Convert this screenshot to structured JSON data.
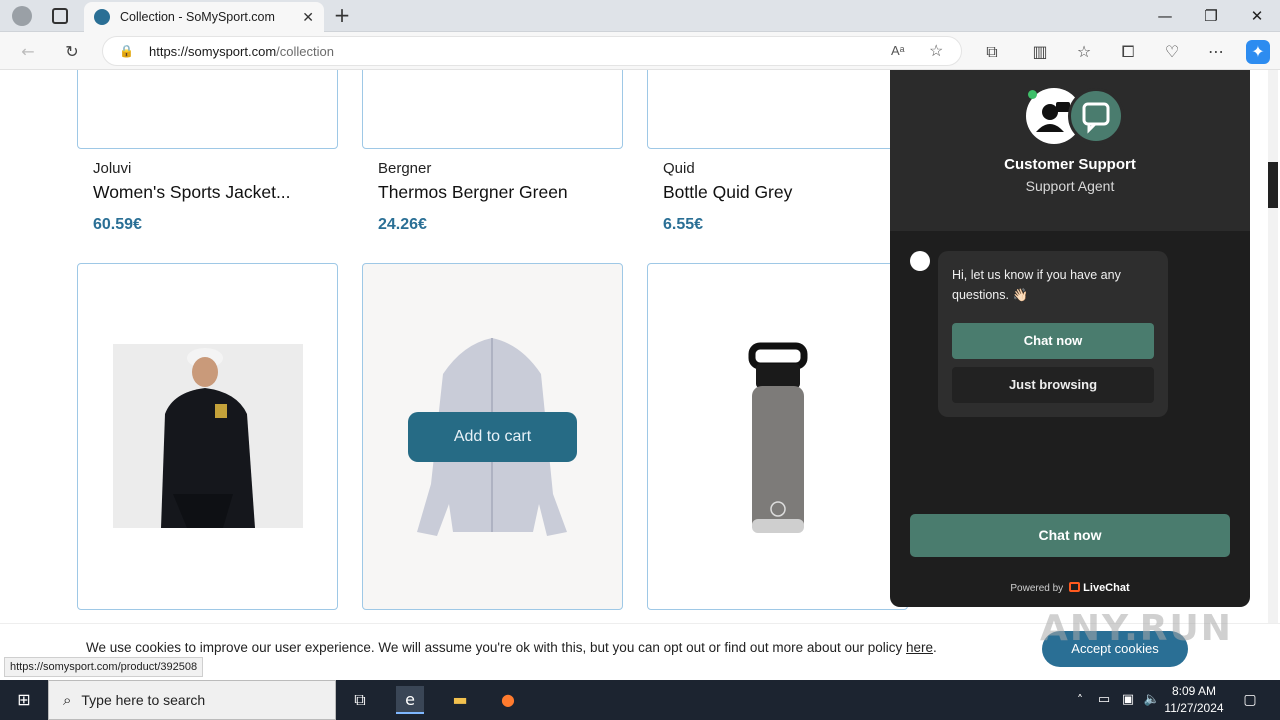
{
  "browser": {
    "tab_title": "Collection - SoMySport.com",
    "url_host": "https://somysport.com",
    "url_path": "/collection",
    "status_url": "https://somysport.com/product/392508"
  },
  "products": [
    {
      "brand": "Joluvi",
      "name": "Women's Sports Jacket...",
      "price": "60.59€"
    },
    {
      "brand": "Bergner",
      "name": "Thermos Bergner Green",
      "price": "24.26€"
    },
    {
      "brand": "Quid",
      "name": "Bottle Quid Grey",
      "price": "6.55€"
    }
  ],
  "add_to_cart": "Add to cart",
  "cookie": {
    "text": "We use cookies to improve our user experience. We will assume you're ok with this, but you can opt out or find out more about our policy ",
    "link": "here",
    "button": "Accept cookies"
  },
  "chat": {
    "title": "Customer Support",
    "subtitle": "Support Agent",
    "message": "Hi, let us know if you have any questions. 👋🏻",
    "chat_now": "Chat now",
    "just_browsing": "Just browsing",
    "big_chat_now": "Chat now",
    "powered_prefix": "Powered by",
    "powered_brand": "LiveChat"
  },
  "watermark": "ANY.RUN",
  "taskbar": {
    "search_placeholder": "Type here to search",
    "time": "8:09 AM",
    "date": "11/27/2024"
  },
  "colors": {
    "accent": "#2a6f95",
    "chat_green": "#4a7c6e"
  }
}
